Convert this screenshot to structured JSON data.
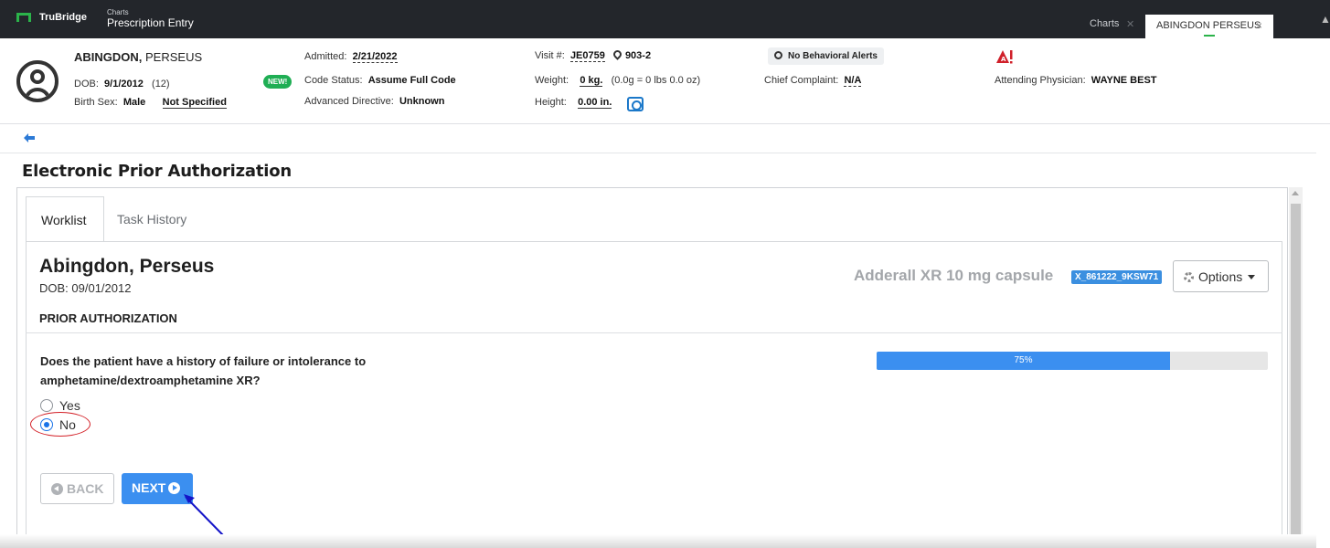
{
  "app": {
    "brand": "TruBridge",
    "breadcrumb_small": "Charts",
    "breadcrumb_main": "Prescription Entry",
    "tabs": [
      {
        "label": "Charts"
      },
      {
        "label": "ABINGDON PERSEUS"
      }
    ]
  },
  "patient": {
    "last_name": "ABINGDON,",
    "first_name": "PERSEUS",
    "dob_label": "DOB:",
    "dob": "9/1/2012",
    "age": "(12)",
    "birth_sex_label": "Birth Sex:",
    "birth_sex": "Male",
    "gender_identity": "Not Specified",
    "new_badge": "NEW!",
    "admitted_label": "Admitted:",
    "admitted": "2/21/2022",
    "code_status_label": "Code Status:",
    "code_status": "Assume Full Code",
    "adv_directive_label": "Advanced Directive:",
    "adv_directive": "Unknown",
    "visit_label": "Visit #:",
    "visit": "JE0759",
    "room": "903-2",
    "weight_label": "Weight:",
    "weight": "0 kg.",
    "weight_detail": "(0.0g = 0 lbs 0.0 oz)",
    "height_label": "Height:",
    "height": "0.00 in.",
    "behavioral_alerts": "No Behavioral Alerts",
    "chief_complaint_label": "Chief Complaint:",
    "chief_complaint": "N/A",
    "attending_label": "Attending Physician:",
    "attending": "WAYNE BEST"
  },
  "page": {
    "title": "Electronic Prior Authorization",
    "tabs": [
      {
        "label": "Worklist"
      },
      {
        "label": "Task History"
      }
    ],
    "patient_name": "Abingdon, Perseus",
    "patient_dob": "DOB: 09/01/2012",
    "drug": "Adderall XR 10 mg capsule",
    "drug_id": "X_861222_9KSW71",
    "options_label": "Options",
    "section_heading": "PRIOR AUTHORIZATION",
    "question": "Does the patient have a history of failure or intolerance to amphetamine/dextroamphetamine XR?",
    "answers": [
      {
        "label": "Yes",
        "selected": false
      },
      {
        "label": "No",
        "selected": true
      }
    ],
    "progress": {
      "value": 0.75,
      "label": "75%"
    },
    "back_label": "BACK",
    "next_label": "NEXT"
  },
  "colors": {
    "accent": "#3b8ff0",
    "topbar": "#23262b",
    "brand_green": "#2bb34a",
    "annotation_red": "#d32027",
    "annotation_arrow": "#1414c8"
  }
}
